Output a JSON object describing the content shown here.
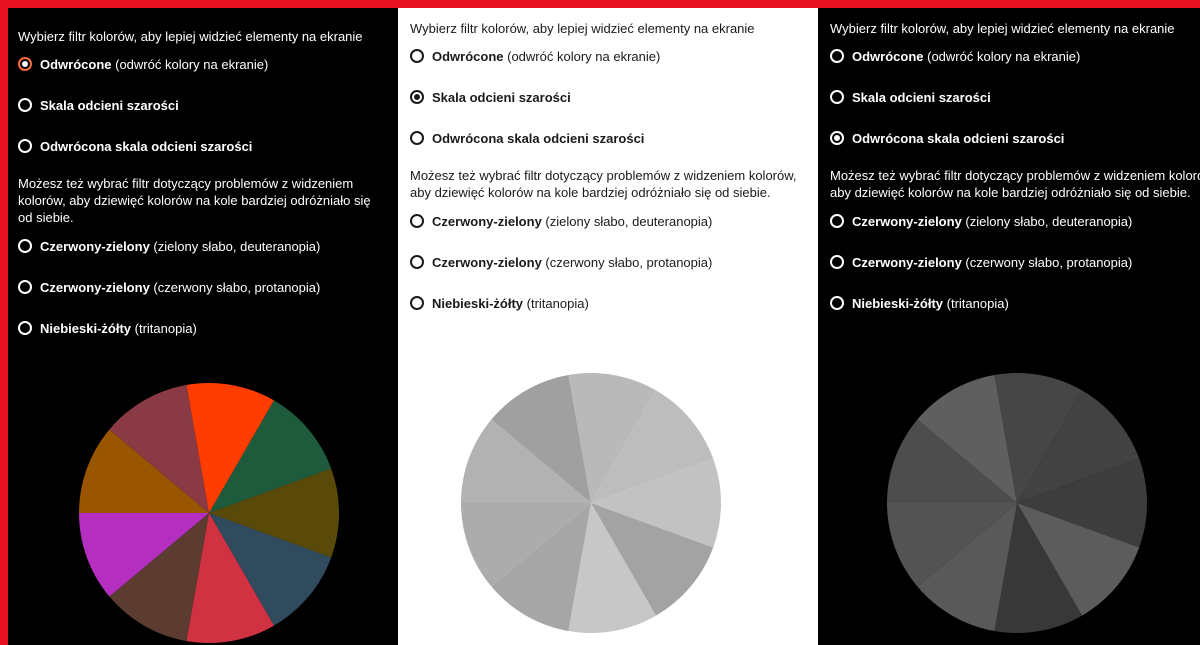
{
  "panels": [
    {
      "id": "inverted",
      "prompt": "Wybierz filtr kolorów, aby lepiej widzieć elementy na ekranie",
      "options": [
        {
          "bold": "Odwrócone",
          "rest": " (odwróć kolory na ekranie)",
          "checked": true
        },
        {
          "bold": "Skala odcieni szarości",
          "rest": "",
          "checked": false
        },
        {
          "bold": "Odwrócona skala odcieni szarości",
          "rest": "",
          "checked": false
        }
      ],
      "description": "Możesz też wybrać filtr dotyczący problemów z widzeniem kolorów, aby dziewięć kolorów na kole bardziej odróżniało się od siebie.",
      "cvd_options": [
        {
          "bold": "Czerwony-zielony",
          "rest": " (zielony słabo, deuteranopia)",
          "checked": false
        },
        {
          "bold": "Czerwony-zielony",
          "rest": " (czerwony słabo, protanopia)",
          "checked": false
        },
        {
          "bold": "Niebieski-żółty",
          "rest": " (tritanopia)",
          "checked": false
        }
      ],
      "pie_colors": [
        "#ff3d00",
        "#1e5a3c",
        "#5a4a0a",
        "#304a5e",
        "#d03242",
        "#5c3b30",
        "#b42ec0",
        "#9a5500",
        "#8a3a44"
      ]
    },
    {
      "id": "grayscale",
      "prompt": "Wybierz filtr kolorów, aby lepiej widzieć elementy na ekranie",
      "options": [
        {
          "bold": "Odwrócone",
          "rest": " (odwróć kolory na ekranie)",
          "checked": false
        },
        {
          "bold": "Skala odcieni szarości",
          "rest": "",
          "checked": true
        },
        {
          "bold": "Odwrócona skala odcieni szarości",
          "rest": "",
          "checked": false
        }
      ],
      "description": "Możesz też wybrać filtr dotyczący problemów z widzeniem kolorów, aby dziewięć kolorów na kole bardziej odróżniało się od siebie.",
      "cvd_options": [
        {
          "bold": "Czerwony-zielony",
          "rest": " (zielony słabo, deuteranopia)",
          "checked": false
        },
        {
          "bold": "Czerwony-zielony",
          "rest": " (czerwony słabo, protanopia)",
          "checked": false
        },
        {
          "bold": "Niebieski-żółty",
          "rest": " (tritanopia)",
          "checked": false
        }
      ],
      "pie_colors": [
        "#b9b9b9",
        "#bdbdbd",
        "#c2c2c2",
        "#a3a3a3",
        "#c7c7c7",
        "#a6a6a6",
        "#acacac",
        "#b2b2b2",
        "#a0a0a0"
      ]
    },
    {
      "id": "inverted-grayscale",
      "prompt": "Wybierz filtr kolorów, aby lepiej widzieć elementy na ekranie",
      "options": [
        {
          "bold": "Odwrócone",
          "rest": " (odwróć kolory na ekranie)",
          "checked": false
        },
        {
          "bold": "Skala odcieni szarości",
          "rest": "",
          "checked": false
        },
        {
          "bold": "Odwrócona skala odcieni szarości",
          "rest": "",
          "checked": true
        }
      ],
      "description": "Możesz też wybrać filtr dotyczący problemów z widzeniem kolorów, aby dziewięć kolorów na kole bardziej odróżniało się od siebie.",
      "cvd_options": [
        {
          "bold": "Czerwony-zielony",
          "rest": " (zielony słabo, deuteranopia)",
          "checked": false
        },
        {
          "bold": "Czerwony-zielony",
          "rest": " (czerwony słabo, protanopia)",
          "checked": false
        },
        {
          "bold": "Niebieski-żółty",
          "rest": " (tritanopia)",
          "checked": false
        }
      ],
      "pie_colors": [
        "#464646",
        "#424242",
        "#3d3d3d",
        "#5c5c5c",
        "#383838",
        "#595959",
        "#535353",
        "#4d4d4d",
        "#5f5f5f"
      ]
    }
  ]
}
